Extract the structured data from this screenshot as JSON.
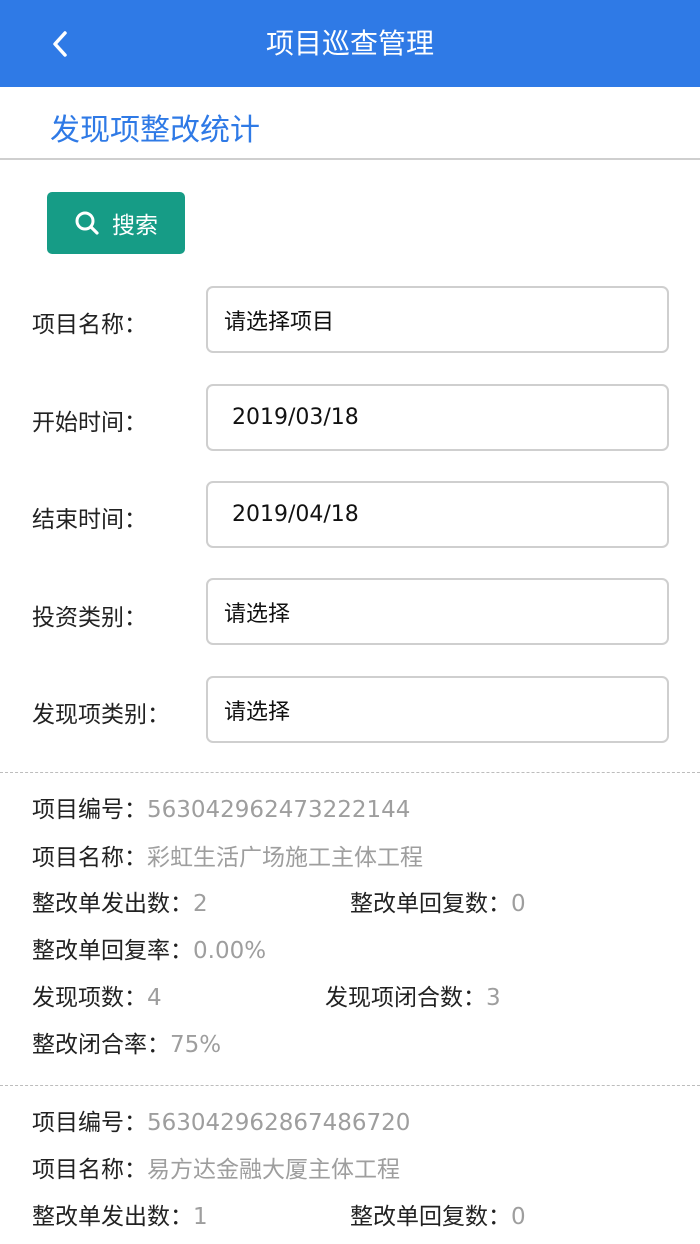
{
  "header": {
    "title": "项目巡查管理",
    "back_icon": "chevron-left-icon",
    "bg_color": "#2f7ae6"
  },
  "section": {
    "title": "发现项整改统计"
  },
  "search": {
    "label": "搜索",
    "icon": "search-icon",
    "color": "#169c86"
  },
  "form": {
    "project_name": {
      "label": "项目名称：",
      "value": "请选择项目"
    },
    "start_time": {
      "label": "开始时间：",
      "value": "2019/03/18"
    },
    "end_time": {
      "label": "结束时间：",
      "value": "2019/04/18"
    },
    "investment_type": {
      "label": "投资类别：",
      "value": "请选择"
    },
    "finding_type": {
      "label": "发现项类别：",
      "value": "请选择"
    }
  },
  "labels": {
    "project_no": "项目编号：",
    "project_name": "项目名称：",
    "issued": "整改单发出数：",
    "replied": "整改单回复数：",
    "reply_rate": "整改单回复率：",
    "findings": "发现项数：",
    "closed_findings": "发现项闭合数：",
    "close_rate": "整改闭合率："
  },
  "records": [
    {
      "project_no": "563042962473222144",
      "project_name": "彩虹生活广场施工主体工程",
      "issued": "2",
      "replied": "0",
      "reply_rate": "0.00%",
      "findings": "4",
      "closed_findings": "3",
      "close_rate": "75%"
    },
    {
      "project_no": "563042962867486720",
      "project_name": "易方达金融大厦主体工程",
      "issued": "1",
      "replied": "0"
    }
  ]
}
